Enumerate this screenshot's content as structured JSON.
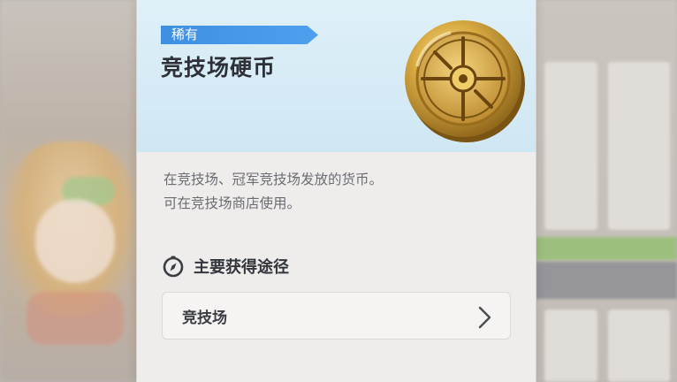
{
  "item": {
    "rarity": "稀有",
    "name": "竞技场硬币",
    "description_lines": [
      "在竞技场、冠军竞技场发放的货币。",
      "可在竞技场商店使用。"
    ]
  },
  "sources": {
    "title": "主要获得途径",
    "icon": "compass-icon",
    "items": [
      {
        "label": "竞技场",
        "icon": "chevron-right-icon"
      }
    ]
  },
  "colors": {
    "rarity_tag": "#3f8fe0",
    "header_bg": "#dff0f9",
    "card_bg": "#efedeb",
    "coin_gold": "#c99a2e"
  }
}
